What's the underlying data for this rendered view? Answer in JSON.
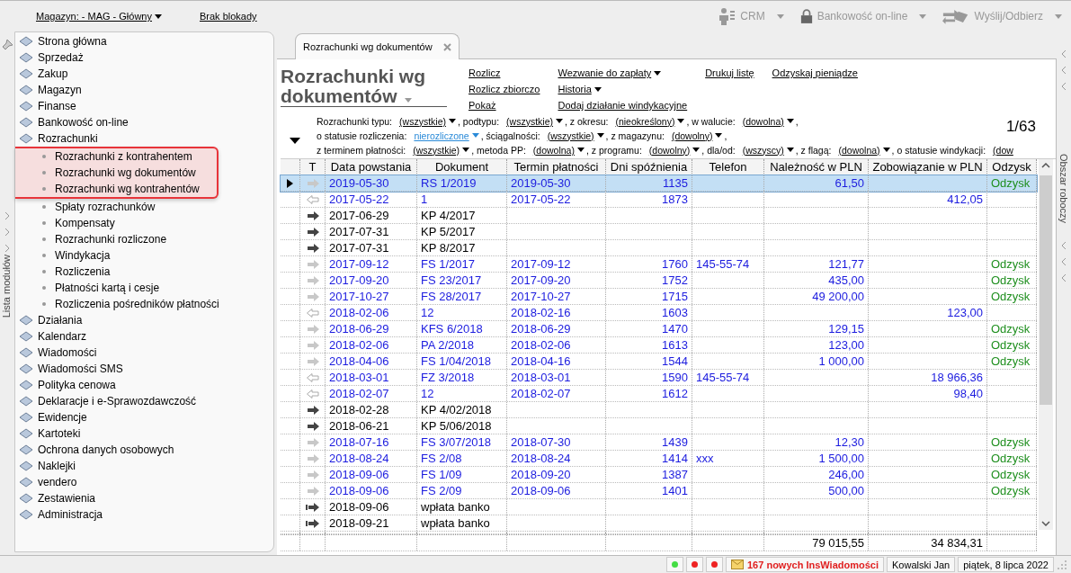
{
  "top_bar": {
    "warehouse": "Magazyn: - MAG - Główny",
    "lock_status": "Brak blokady",
    "tools": [
      {
        "label": "CRM",
        "disabled": true
      },
      {
        "label": "Bankowość on-line",
        "disabled": true
      },
      {
        "label": "Wyślij/Odbierz",
        "disabled": true
      }
    ]
  },
  "left_strip": {
    "label": "Lista modułów"
  },
  "right_strip": {
    "label": "Obszar roboczy"
  },
  "sidebar": {
    "items": [
      {
        "label": "Strona główna"
      },
      {
        "label": "Sprzedaż"
      },
      {
        "label": "Zakup"
      },
      {
        "label": "Magazyn"
      },
      {
        "label": "Finanse"
      },
      {
        "label": "Bankowość on-line"
      },
      {
        "label": "Rozrachunki",
        "children": [
          {
            "label": "Rozrachunki z kontrahentem",
            "highlighted": true
          },
          {
            "label": "Rozrachunki wg dokumentów",
            "highlighted": true
          },
          {
            "label": "Rozrachunki wg kontrahentów",
            "highlighted": true
          },
          {
            "label": "Spłaty rozrachunków",
            "highlighted": false
          },
          {
            "label": "Kompensaty",
            "highlighted": false
          },
          {
            "label": "Rozrachunki rozliczone",
            "highlighted": false
          },
          {
            "label": "Windykacja",
            "highlighted": false
          },
          {
            "label": "Rozliczenia",
            "highlighted": false
          },
          {
            "label": "Płatności kartą i cesje",
            "highlighted": false
          },
          {
            "label": "Rozliczenia pośredników płatności",
            "highlighted": false
          }
        ]
      },
      {
        "label": "Działania"
      },
      {
        "label": "Kalendarz"
      },
      {
        "label": "Wiadomości"
      },
      {
        "label": "Wiadomości SMS"
      },
      {
        "label": "Polityka cenowa"
      },
      {
        "label": "Deklaracje i e-Sprawozdawczość"
      },
      {
        "label": "Ewidencje"
      },
      {
        "label": "Kartoteki"
      },
      {
        "label": "Ochrona danych osobowych"
      },
      {
        "label": "Naklejki"
      },
      {
        "label": "vendero"
      },
      {
        "label": "Zestawienia"
      },
      {
        "label": "Administracja"
      }
    ]
  },
  "tab": {
    "label": "Rozrachunki wg dokumentów"
  },
  "title": "Rozrachunki wg dokumentów",
  "actions": [
    [
      {
        "label": "Rozlicz",
        "menu": false
      },
      {
        "label": "Rozlicz zbiorczo",
        "menu": false
      },
      {
        "label": "Pokaż",
        "menu": false
      }
    ],
    [
      {
        "label": "Wezwanie do zapłaty",
        "menu": true
      },
      {
        "label": "Historia",
        "menu": true
      },
      {
        "label": "Dodaj działanie windykacyjne",
        "menu": false
      }
    ],
    [
      {
        "label": "Drukuj listę",
        "menu": false
      }
    ],
    [
      {
        "label": "Odzyskaj pieniądze",
        "menu": false
      }
    ]
  ],
  "counter": "1/63",
  "filters": [
    {
      "items": [
        {
          "label": "Rozrachunki typu:",
          "value": "(wszystkie)",
          "active": false,
          "menu": true
        },
        {
          "label": ", podtypu:",
          "value": "(wszystkie)",
          "active": false,
          "menu": true
        },
        {
          "label": ", z okresu:",
          "value": "(nieokreślony)",
          "active": false,
          "menu": true
        },
        {
          "label": ", w walucie:",
          "value": "(dowolna)",
          "active": false,
          "menu": true
        }
      ],
      "tail": ","
    },
    {
      "items": [
        {
          "label": "o statusie rozliczenia:",
          "value": "nierozliczone",
          "active": true,
          "menu": true
        },
        {
          "label": ", ściągalności:",
          "value": "(wszystkie)",
          "active": false,
          "menu": true
        },
        {
          "label": ", z magazynu:",
          "value": "(dowolny)",
          "active": false,
          "menu": true
        }
      ],
      "tail": ","
    },
    {
      "items": [
        {
          "label": "z terminem płatności:",
          "value": "(wszystkie)",
          "active": false,
          "menu": true
        },
        {
          "label": ", metoda PP:",
          "value": "(dowolna)",
          "active": false,
          "menu": true
        },
        {
          "label": ", z programu:",
          "value": "(dowolny)",
          "active": false,
          "menu": true
        },
        {
          "label": ", dla/od:",
          "value": "(wszyscy)",
          "active": false,
          "menu": true
        },
        {
          "label": ", z flagą:",
          "value": "(dowolna)",
          "active": false,
          "menu": true
        },
        {
          "label": ", o statusie windykacji:",
          "value": "(dow",
          "active": false,
          "menu": false
        }
      ]
    }
  ],
  "table": {
    "columns": [
      "T",
      "Data powstania",
      "Dokument",
      "Termin płatności",
      "Dni spóźnienia",
      "Telefon",
      "Należność w PLN",
      "Zobowiązanie w PLN",
      "Odzysk"
    ],
    "rows": [
      {
        "selected": true,
        "kind": "outgoing",
        "date": "2019-05-30",
        "document": "RS 1/2019",
        "due": "2019-05-30",
        "days_late": "1135",
        "receivable": "61,50",
        "recovery": "Odzysk"
      },
      {
        "selected": false,
        "kind": "incoming",
        "date": "2017-05-22",
        "document": "1",
        "due": "2017-05-22",
        "days_late": "1873",
        "liability": "412,05"
      },
      {
        "selected": false,
        "kind": "cash",
        "date": "2017-06-29",
        "document": "KP 4/2017"
      },
      {
        "selected": false,
        "kind": "cash",
        "date": "2017-07-31",
        "document": "KP 5/2017"
      },
      {
        "selected": false,
        "kind": "cash",
        "date": "2017-07-31",
        "document": "KP 8/2017"
      },
      {
        "selected": false,
        "kind": "outgoing",
        "date": "2017-09-12",
        "document": "FS 1/2017",
        "due": "2017-09-12",
        "days_late": "1760",
        "phone": "145-55-74",
        "receivable": "121,77",
        "recovery": "Odzysk"
      },
      {
        "selected": false,
        "kind": "outgoing",
        "date": "2017-09-20",
        "document": "FS 23/2017",
        "due": "2017-09-20",
        "days_late": "1752",
        "receivable": "435,00",
        "recovery": "Odzysk"
      },
      {
        "selected": false,
        "kind": "outgoing",
        "date": "2017-10-27",
        "document": "FS 28/2017",
        "due": "2017-10-27",
        "days_late": "1715",
        "receivable": "49 200,00",
        "recovery": "Odzysk"
      },
      {
        "selected": false,
        "kind": "incoming",
        "date": "2018-02-06",
        "document": "12",
        "due": "2018-02-16",
        "days_late": "1603",
        "liability": "123,00"
      },
      {
        "selected": false,
        "kind": "outgoing",
        "date": "2018-06-29",
        "document": "KFS 6/2018",
        "due": "2018-06-29",
        "days_late": "1470",
        "receivable": "129,15",
        "recovery": "Odzysk"
      },
      {
        "selected": false,
        "kind": "outgoing",
        "date": "2018-02-06",
        "document": "PA 2/2018",
        "due": "2018-02-06",
        "days_late": "1613",
        "receivable": "123,00",
        "recovery": "Odzysk"
      },
      {
        "selected": false,
        "kind": "outgoing",
        "date": "2018-04-06",
        "document": "FS 1/04/2018",
        "due": "2018-04-16",
        "days_late": "1544",
        "receivable": "1 000,00",
        "recovery": "Odzysk"
      },
      {
        "selected": false,
        "kind": "incoming",
        "date": "2018-03-01",
        "document": "FZ 3/2018",
        "due": "2018-03-01",
        "days_late": "1590",
        "phone": "145-55-74",
        "liability": "18 966,36"
      },
      {
        "selected": false,
        "kind": "incoming",
        "date": "2018-02-07",
        "document": "12",
        "due": "2018-02-07",
        "days_late": "1612",
        "liability": "98,40"
      },
      {
        "selected": false,
        "kind": "cash",
        "date": "2018-02-28",
        "document": "KP 4/02/2018"
      },
      {
        "selected": false,
        "kind": "cash",
        "date": "2018-06-21",
        "document": "KP 5/06/2018"
      },
      {
        "selected": false,
        "kind": "outgoing",
        "date": "2018-07-16",
        "document": "FS 3/07/2018",
        "due": "2018-07-30",
        "days_late": "1439",
        "receivable": "12,30",
        "recovery": "Odzysk"
      },
      {
        "selected": false,
        "kind": "outgoing",
        "date": "2018-08-24",
        "document": "FS 2/08",
        "due": "2018-08-24",
        "days_late": "1414",
        "phone": "xxx",
        "receivable": "1 500,00",
        "recovery": "Odzysk"
      },
      {
        "selected": false,
        "kind": "outgoing",
        "date": "2018-09-06",
        "document": "FS 1/09",
        "due": "2018-09-20",
        "days_late": "1387",
        "receivable": "246,00",
        "recovery": "Odzysk"
      },
      {
        "selected": false,
        "kind": "outgoing",
        "date": "2018-09-06",
        "document": "FS 2/09",
        "due": "2018-09-06",
        "days_late": "1401",
        "receivable": "500,00",
        "recovery": "Odzysk"
      },
      {
        "selected": false,
        "kind": "bank",
        "date": "2018-09-06",
        "document": "wpłata banko"
      },
      {
        "selected": false,
        "kind": "bank",
        "date": "2018-09-21",
        "document": "wpłata banko"
      }
    ],
    "totals": {
      "receivable": "79 015,55",
      "liability": "34 834,31"
    }
  },
  "status_bar": {
    "indicators": [
      {
        "color": "#44dd44"
      },
      {
        "color": "#ee2222"
      },
      {
        "color": "#ee2222"
      }
    ],
    "messages": "167 nowych InsWiadomości",
    "user": "Kowalski Jan",
    "date": "piątek, 8 lipca 2022"
  }
}
